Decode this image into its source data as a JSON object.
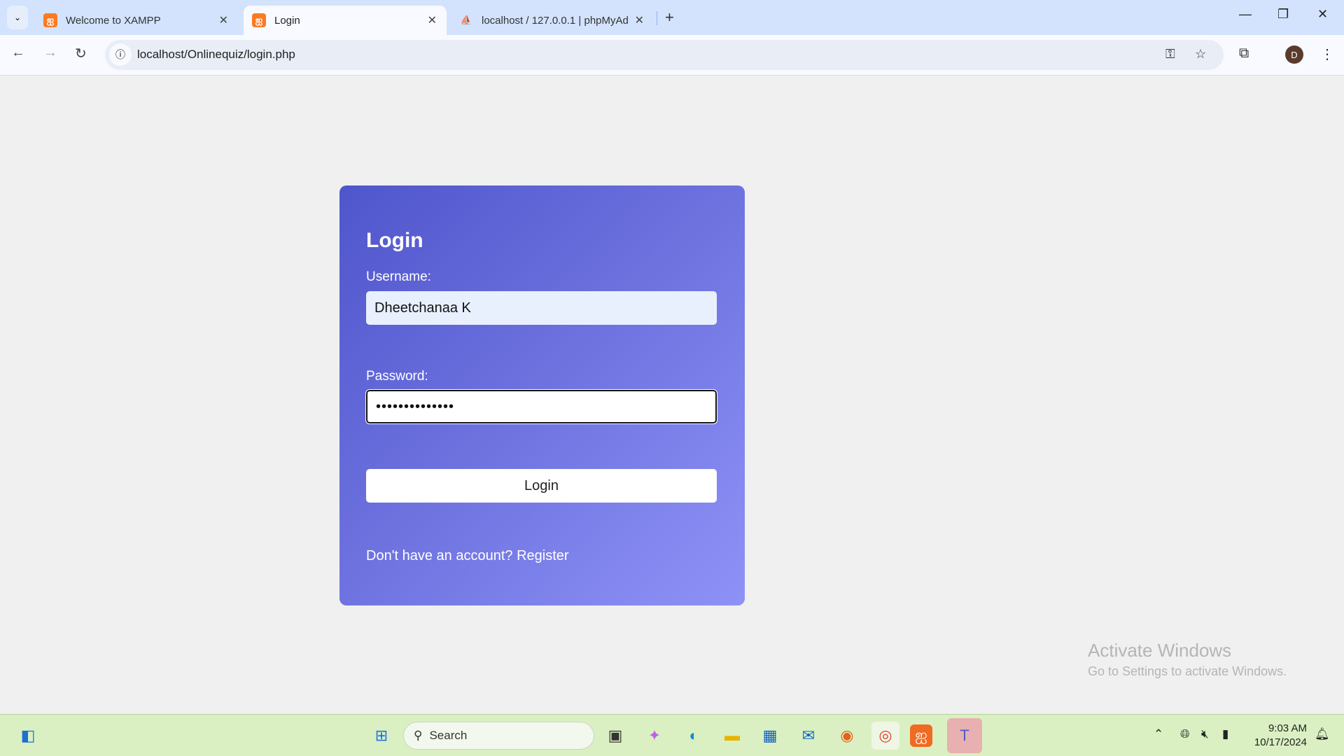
{
  "browser": {
    "tabs": [
      {
        "title": "Welcome to XAMPP",
        "icon": "xampp-icon"
      },
      {
        "title": "Login",
        "icon": "xampp-icon",
        "active": true
      },
      {
        "title": "localhost / 127.0.0.1 | phpMyAd",
        "icon": "phpmyadmin-icon"
      }
    ],
    "url": "localhost/Onlinequiz/login.php",
    "profile_initial": "D"
  },
  "login": {
    "title": "Login",
    "username_label": "Username:",
    "username_value": "Dheetchanaa K",
    "password_label": "Password:",
    "password_value": "••••••••••••••",
    "button": "Login",
    "register_text": "Don't have an account? Register"
  },
  "watermark": {
    "title": "Activate Windows",
    "subtitle": "Go to Settings to activate Windows."
  },
  "taskbar": {
    "search_placeholder": "Search",
    "time": "9:03 AM",
    "date": "10/17/2024"
  }
}
